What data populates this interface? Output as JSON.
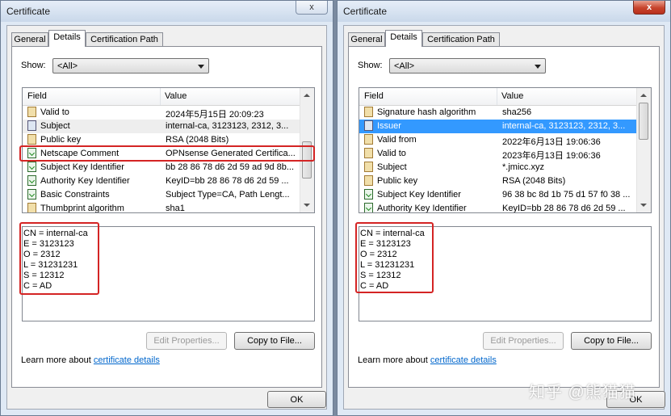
{
  "left": {
    "title": "Certificate",
    "close": "x",
    "tabs": [
      "General",
      "Details",
      "Certification Path"
    ],
    "show_label": "Show:",
    "show_value": "<All>",
    "col_field": "Field",
    "col_value": "Value",
    "rows": [
      {
        "field": "Valid to",
        "value": "2024年5月15日 20:09:23"
      },
      {
        "field": "Subject",
        "value": "internal-ca, 3123123, 2312, 3..."
      },
      {
        "field": "Public key",
        "value": "RSA (2048 Bits)"
      },
      {
        "field": "Netscape Comment",
        "value": "OPNsense Generated Certifica..."
      },
      {
        "field": "Subject Key Identifier",
        "value": "bb 28 86 78 d6 2d 59 ad 9d 8b..."
      },
      {
        "field": "Authority Key Identifier",
        "value": "KeyID=bb 28 86 78 d6 2d 59 ..."
      },
      {
        "field": "Basic Constraints",
        "value": "Subject Type=CA, Path Lengt..."
      },
      {
        "field": "Thumbprint algorithm",
        "value": "sha1"
      }
    ],
    "detail_lines": [
      "CN = internal-ca",
      "E = 3123123",
      "O = 2312",
      "L = 31231231",
      "S = 12312",
      "C = AD"
    ],
    "edit_properties": "Edit Properties...",
    "copy_to_file": "Copy to File...",
    "learn_text": "Learn more about ",
    "learn_link": "certificate details",
    "ok": "OK"
  },
  "right": {
    "title": "Certificate",
    "close": "x",
    "tabs": [
      "General",
      "Details",
      "Certification Path"
    ],
    "show_label": "Show:",
    "show_value": "<All>",
    "col_field": "Field",
    "col_value": "Value",
    "rows": [
      {
        "field": "Signature hash algorithm",
        "value": "sha256"
      },
      {
        "field": "Issuer",
        "value": "internal-ca, 3123123, 2312, 3..."
      },
      {
        "field": "Valid from",
        "value": "2022年6月13日 19:06:36"
      },
      {
        "field": "Valid to",
        "value": "2023年6月13日 19:06:36"
      },
      {
        "field": "Subject",
        "value": "*.jmicc.xyz"
      },
      {
        "field": "Public key",
        "value": "RSA (2048 Bits)"
      },
      {
        "field": "Subject Key Identifier",
        "value": "96 38 bc 8d 1b 75 d1 57 f0 38 ..."
      },
      {
        "field": "Authority Key Identifier",
        "value": "KeyID=bb 28 86 78 d6 2d 59 ..."
      }
    ],
    "detail_lines": [
      "CN = internal-ca",
      "E = 3123123",
      "O = 2312",
      "L = 31231231",
      "S = 12312",
      "C = AD"
    ],
    "edit_properties": "Edit Properties...",
    "copy_to_file": "Copy to File...",
    "learn_text": "Learn more about ",
    "learn_link": "certificate details",
    "ok": "OK"
  },
  "watermark": "知乎 @熊猫猫"
}
